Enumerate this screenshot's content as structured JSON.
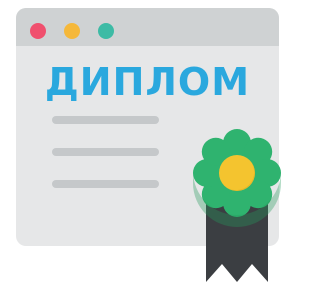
{
  "window": {
    "title": "ДИПЛОМ",
    "buttons": [
      "close-dot",
      "minimize-dot",
      "maximize-dot"
    ]
  },
  "icons": {
    "award": "rosette-ribbon-icon"
  },
  "colors": {
    "title_bar": "#cfd2d3",
    "window_body": "#e6e7e8",
    "close": "#f0506e",
    "minimize": "#f5b83a",
    "maximize": "#3dbba5",
    "title_text": "#2aa8de",
    "placeholder_line": "#c5c8ca",
    "rosette": "#2fb36f",
    "rosette_dark": "#249a5c",
    "rosette_center": "#f4c42f",
    "ribbon": "#3b3e42"
  }
}
